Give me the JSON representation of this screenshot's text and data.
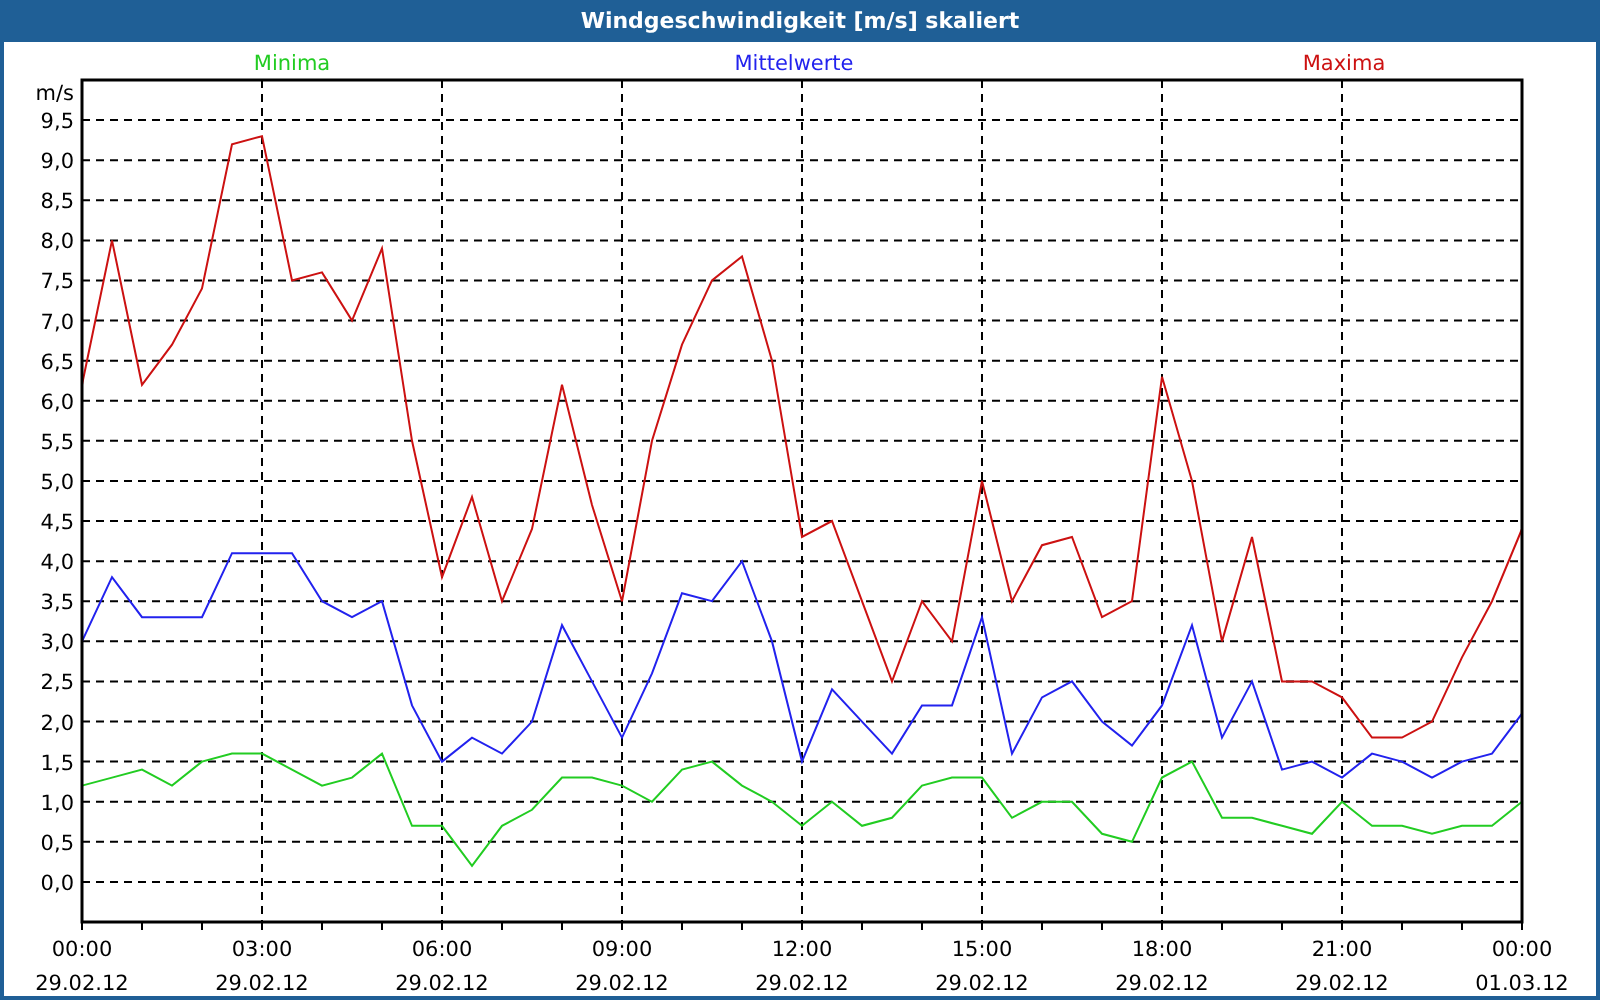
{
  "window": {
    "title": "Windgeschwindigkeit [m/s] skaliert"
  },
  "chart": {
    "chart_data": {
      "type": "line",
      "ylabel": "m/s",
      "categories": [
        "00:00\n29.02.12",
        null,
        null,
        null,
        null,
        null,
        "03:00\n29.02.12",
        null,
        null,
        null,
        null,
        null,
        "06:00\n29.02.12",
        null,
        null,
        null,
        null,
        null,
        "09:00\n29.02.12",
        null,
        null,
        null,
        null,
        null,
        "12:00\n29.02.12",
        null,
        null,
        null,
        null,
        null,
        "15:00\n29.02.12",
        null,
        null,
        null,
        null,
        null,
        "18:00\n29.02.12",
        null,
        null,
        null,
        null,
        null,
        "21:00\n29.02.12",
        null,
        null,
        null,
        null,
        null,
        "00:00\n01.03.12"
      ],
      "ylim": [
        -0.5,
        10
      ],
      "grid": true,
      "yticks": [
        {
          "value": 0,
          "label": "0,0"
        },
        {
          "value": 0.5,
          "label": "0,5"
        },
        {
          "value": 1,
          "label": "1,0"
        },
        {
          "value": 1.5,
          "label": "1,5"
        },
        {
          "value": 2,
          "label": "2,0"
        },
        {
          "value": 2.5,
          "label": "2,5"
        },
        {
          "value": 3,
          "label": "3,0"
        },
        {
          "value": 3.5,
          "label": "3,5"
        },
        {
          "value": 4,
          "label": "4,0"
        },
        {
          "value": 4.5,
          "label": "4,5"
        },
        {
          "value": 5,
          "label": "5,0"
        },
        {
          "value": 5.5,
          "label": "5,5"
        },
        {
          "value": 6,
          "label": "6,0"
        },
        {
          "value": 6.5,
          "label": "6,5"
        },
        {
          "value": 7,
          "label": "7,0"
        },
        {
          "value": 7.5,
          "label": "7,5"
        },
        {
          "value": 8,
          "label": "8,0"
        },
        {
          "value": 8.5,
          "label": "8,5"
        },
        {
          "value": 9,
          "label": "9,0"
        },
        {
          "value": 9.5,
          "label": "9,5"
        }
      ],
      "series": [
        {
          "name": "Minima",
          "color": "#22cc22",
          "values": [
            1.2,
            1.3,
            1.4,
            1.2,
            1.5,
            1.6,
            1.6,
            1.4,
            1.2,
            1.3,
            1.6,
            0.7,
            0.7,
            0.2,
            0.7,
            0.9,
            1.3,
            1.3,
            1.2,
            1.0,
            1.4,
            1.5,
            1.2,
            1.0,
            0.7,
            1.0,
            0.7,
            0.8,
            1.2,
            1.3,
            1.3,
            0.8,
            1.0,
            1.0,
            0.6,
            0.5,
            1.3,
            1.5,
            0.8,
            0.8,
            0.7,
            0.6,
            1.0,
            0.7,
            0.7,
            0.6,
            0.7,
            0.7,
            1.0
          ]
        },
        {
          "name": "Mittelwerte",
          "color": "#2222ee",
          "values": [
            3.0,
            3.8,
            3.3,
            3.3,
            3.3,
            4.1,
            4.1,
            4.1,
            3.5,
            3.3,
            3.5,
            2.2,
            1.5,
            1.8,
            1.6,
            2.0,
            3.2,
            2.5,
            1.8,
            2.6,
            3.6,
            3.5,
            4.0,
            3.0,
            1.5,
            2.4,
            2.0,
            1.6,
            2.2,
            2.2,
            3.3,
            1.6,
            2.3,
            2.5,
            2.0,
            1.7,
            2.2,
            3.2,
            1.8,
            2.5,
            1.4,
            1.5,
            1.3,
            1.6,
            1.5,
            1.3,
            1.5,
            1.6,
            2.1
          ]
        },
        {
          "name": "Maxima",
          "color": "#cc1111",
          "values": [
            6.2,
            8.0,
            6.2,
            6.7,
            7.4,
            9.2,
            9.3,
            7.5,
            7.6,
            7.0,
            7.9,
            5.5,
            3.8,
            4.8,
            3.5,
            4.4,
            6.2,
            4.7,
            3.5,
            5.5,
            6.7,
            7.5,
            7.8,
            6.5,
            4.3,
            4.5,
            3.5,
            2.5,
            3.5,
            3.0,
            5.0,
            3.5,
            4.2,
            4.3,
            3.3,
            3.5,
            6.3,
            5.0,
            3.0,
            4.3,
            2.5,
            2.5,
            2.3,
            1.8,
            1.8,
            2.0,
            2.8,
            3.5,
            4.4
          ]
        }
      ]
    }
  }
}
